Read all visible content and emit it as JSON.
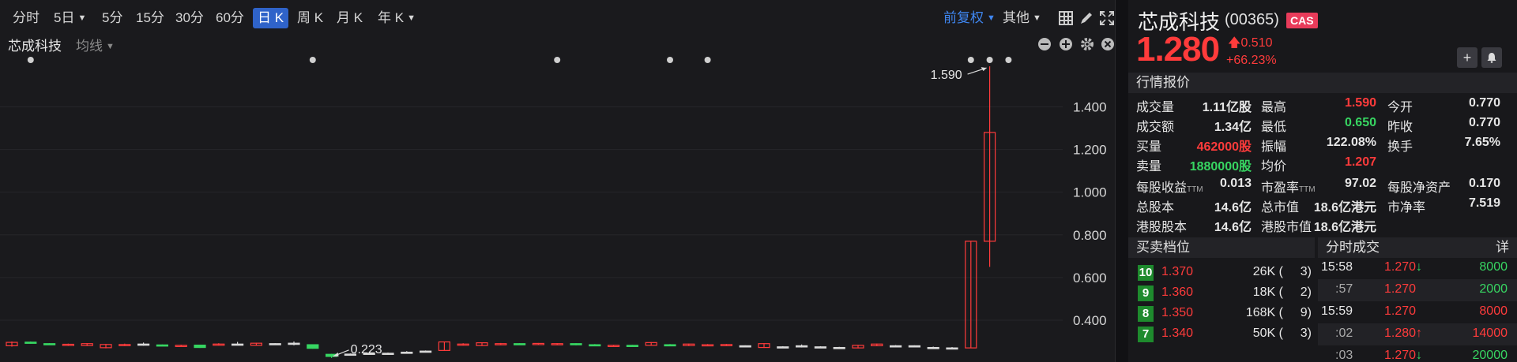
{
  "toolbar": {
    "periods": [
      "分时",
      "5日",
      "5分",
      "15分",
      "30分",
      "60分",
      "日 K",
      "周 K",
      "月 K",
      "年 K"
    ],
    "active_period": "日 K",
    "adjust": "前复权",
    "other": "其他"
  },
  "subbar": {
    "stock_name": "芯成科技",
    "indicator": "均线"
  },
  "chart_data": {
    "type": "candlestick",
    "y_ticks": [
      "1.400",
      "1.200",
      "1.000",
      "0.800",
      "0.600",
      "0.400"
    ],
    "ylim": [
      0.215,
      1.62
    ],
    "annotations": [
      {
        "label": "1.590",
        "value": 1.59,
        "kind": "high"
      },
      {
        "label": "0.223",
        "value": 0.223,
        "kind": "low"
      }
    ],
    "candles": [
      {
        "o": 0.28,
        "c": 0.296,
        "h": 0.3,
        "l": 0.276
      },
      {
        "o": 0.297,
        "c": 0.296,
        "h": 0.3,
        "l": 0.29
      },
      {
        "o": 0.29,
        "c": 0.286,
        "h": 0.292,
        "l": 0.284
      },
      {
        "o": 0.284,
        "c": 0.287,
        "h": 0.29,
        "l": 0.28
      },
      {
        "o": 0.281,
        "c": 0.29,
        "h": 0.292,
        "l": 0.279
      },
      {
        "o": 0.271,
        "c": 0.286,
        "h": 0.288,
        "l": 0.268
      },
      {
        "o": 0.285,
        "c": 0.286,
        "h": 0.29,
        "l": 0.282
      },
      {
        "o": 0.288,
        "c": 0.288,
        "h": 0.295,
        "l": 0.28
      },
      {
        "o": 0.284,
        "c": 0.281,
        "h": 0.286,
        "l": 0.279
      },
      {
        "o": 0.281,
        "c": 0.282,
        "h": 0.285,
        "l": 0.278
      },
      {
        "o": 0.283,
        "c": 0.272,
        "h": 0.284,
        "l": 0.27
      },
      {
        "o": 0.285,
        "c": 0.288,
        "h": 0.292,
        "l": 0.283
      },
      {
        "o": 0.288,
        "c": 0.288,
        "h": 0.298,
        "l": 0.282
      },
      {
        "o": 0.282,
        "c": 0.292,
        "h": 0.294,
        "l": 0.28
      },
      {
        "o": 0.29,
        "c": 0.29,
        "h": 0.292,
        "l": 0.284
      },
      {
        "o": 0.292,
        "c": 0.292,
        "h": 0.3,
        "l": 0.282
      },
      {
        "o": 0.285,
        "c": 0.268,
        "h": 0.286,
        "l": 0.266
      },
      {
        "o": 0.24,
        "c": 0.23,
        "h": 0.242,
        "l": 0.223
      },
      {
        "o": 0.241,
        "c": 0.241,
        "h": 0.244,
        "l": 0.238
      },
      {
        "o": 0.245,
        "c": 0.245,
        "h": 0.248,
        "l": 0.24
      },
      {
        "o": 0.245,
        "c": 0.245,
        "h": 0.248,
        "l": 0.242
      },
      {
        "o": 0.25,
        "c": 0.25,
        "h": 0.255,
        "l": 0.246
      },
      {
        "o": 0.255,
        "c": 0.255,
        "h": 0.258,
        "l": 0.25
      },
      {
        "o": 0.258,
        "c": 0.298,
        "h": 0.3,
        "l": 0.256
      },
      {
        "o": 0.286,
        "c": 0.288,
        "h": 0.292,
        "l": 0.282
      },
      {
        "o": 0.281,
        "c": 0.294,
        "h": 0.296,
        "l": 0.279
      },
      {
        "o": 0.285,
        "c": 0.29,
        "h": 0.293,
        "l": 0.283
      },
      {
        "o": 0.29,
        "c": 0.288,
        "h": 0.292,
        "l": 0.284
      },
      {
        "o": 0.288,
        "c": 0.291,
        "h": 0.293,
        "l": 0.285
      },
      {
        "o": 0.285,
        "c": 0.29,
        "h": 0.292,
        "l": 0.283
      },
      {
        "o": 0.29,
        "c": 0.285,
        "h": 0.292,
        "l": 0.282
      },
      {
        "o": 0.285,
        "c": 0.28,
        "h": 0.288,
        "l": 0.278
      },
      {
        "o": 0.281,
        "c": 0.282,
        "h": 0.284,
        "l": 0.278
      },
      {
        "o": 0.282,
        "c": 0.28,
        "h": 0.284,
        "l": 0.276
      },
      {
        "o": 0.282,
        "c": 0.295,
        "h": 0.297,
        "l": 0.28
      },
      {
        "o": 0.285,
        "c": 0.284,
        "h": 0.288,
        "l": 0.282
      },
      {
        "o": 0.281,
        "c": 0.288,
        "h": 0.29,
        "l": 0.279
      },
      {
        "o": 0.28,
        "c": 0.285,
        "h": 0.288,
        "l": 0.278
      },
      {
        "o": 0.28,
        "c": 0.286,
        "h": 0.288,
        "l": 0.278
      },
      {
        "o": 0.28,
        "c": 0.28,
        "h": 0.282,
        "l": 0.276
      },
      {
        "o": 0.272,
        "c": 0.29,
        "h": 0.292,
        "l": 0.27
      },
      {
        "o": 0.275,
        "c": 0.275,
        "h": 0.278,
        "l": 0.27
      },
      {
        "o": 0.28,
        "c": 0.28,
        "h": 0.286,
        "l": 0.272
      },
      {
        "o": 0.275,
        "c": 0.275,
        "h": 0.278,
        "l": 0.272
      },
      {
        "o": 0.272,
        "c": 0.272,
        "h": 0.275,
        "l": 0.27
      },
      {
        "o": 0.27,
        "c": 0.282,
        "h": 0.284,
        "l": 0.268
      },
      {
        "o": 0.28,
        "c": 0.288,
        "h": 0.29,
        "l": 0.278
      },
      {
        "o": 0.28,
        "c": 0.28,
        "h": 0.283,
        "l": 0.276
      },
      {
        "o": 0.28,
        "c": 0.28,
        "h": 0.282,
        "l": 0.276
      },
      {
        "o": 0.272,
        "c": 0.272,
        "h": 0.276,
        "l": 0.27
      },
      {
        "o": 0.27,
        "c": 0.27,
        "h": 0.274,
        "l": 0.268
      },
      {
        "o": 0.27,
        "c": 0.77,
        "h": 0.77,
        "l": 0.27
      },
      {
        "o": 0.77,
        "c": 1.28,
        "h": 1.59,
        "l": 0.65
      }
    ],
    "markers": [
      1,
      16,
      29,
      35,
      37,
      51,
      52,
      53
    ]
  },
  "quote": {
    "name": "芯成科技",
    "code": "(00365)",
    "badge": "CAS",
    "price": "1.280",
    "change": "0.510",
    "change_pct": "+66.23%",
    "section_title": "行情报价",
    "rows": [
      [
        [
          "成交量",
          "1.11亿股",
          "white"
        ],
        [
          "最高",
          "1.590",
          "red"
        ],
        [
          "今开",
          "0.770",
          "white"
        ]
      ],
      [
        [
          "成交额",
          "1.34亿",
          "white"
        ],
        [
          "最低",
          "0.650",
          "green"
        ],
        [
          "昨收",
          "0.770",
          "white"
        ]
      ],
      [
        [
          "买量",
          "462000股",
          "red"
        ],
        [
          "振幅",
          "122.08%",
          "white"
        ],
        [
          "换手",
          "7.65%",
          "white"
        ]
      ],
      [
        [
          "卖量",
          "1880000股",
          "green"
        ],
        [
          "均价",
          "1.207",
          "red"
        ],
        [
          "",
          "",
          " white"
        ]
      ],
      [
        [
          "每股收益",
          "0.013",
          "white"
        ],
        [
          "市盈率",
          "97.02",
          "white"
        ],
        [
          "每股净资产",
          "0.170",
          "white"
        ]
      ],
      [
        [
          "总股本",
          "14.6亿",
          "white"
        ],
        [
          "总市值",
          "18.6亿港元",
          "white"
        ],
        [
          "市净率",
          "7.519",
          "white"
        ]
      ],
      [
        [
          "港股股本",
          "14.6亿",
          "white"
        ],
        [
          "港股市值",
          "18.6亿港元",
          "white"
        ],
        [
          "",
          "",
          ""
        ]
      ]
    ],
    "ttm_label": "TTM"
  },
  "orderbook": {
    "title": "买卖档位",
    "rows": [
      {
        "level": "10",
        "price": "1.370",
        "vol": "26K (",
        "cnt": "3)"
      },
      {
        "level": "9",
        "price": "1.360",
        "vol": "18K (",
        "cnt": "2)"
      },
      {
        "level": "8",
        "price": "1.350",
        "vol": "168K (",
        "cnt": "9)"
      },
      {
        "level": "7",
        "price": "1.340",
        "vol": "50K (",
        "cnt": "3)"
      }
    ]
  },
  "trades": {
    "title": "分时成交",
    "detail": "详",
    "rows": [
      {
        "time": "15:58",
        "price": "1.270",
        "dir": "down",
        "vol": "8000",
        "vol_color": "green",
        "short": false
      },
      {
        "time": ":57",
        "price": "1.270",
        "dir": "",
        "vol": "2000",
        "vol_color": "green",
        "short": true
      },
      {
        "time": "15:59",
        "price": "1.270",
        "dir": "",
        "vol": "8000",
        "vol_color": "red",
        "short": false
      },
      {
        "time": ":02",
        "price": "1.280",
        "dir": "up",
        "vol": "14000",
        "vol_color": "red",
        "short": true
      },
      {
        "time": ":03",
        "price": "1.270",
        "dir": "down",
        "vol": "20000",
        "vol_color": "green",
        "short": true
      }
    ]
  }
}
